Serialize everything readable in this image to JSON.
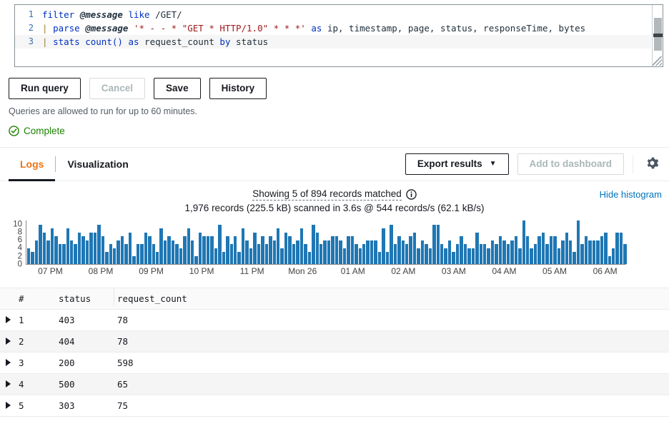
{
  "editor": {
    "lines": [
      {
        "num": "1",
        "text": "filter @message like /GET/"
      },
      {
        "num": "2",
        "text": "| parse @message '* - - * \"GET * HTTP/1.0\" * * *' as ip, timestamp, page, status, responseTime, bytes"
      },
      {
        "num": "3",
        "text": "| stats count() as request_count by status"
      }
    ],
    "tokens": {
      "kw_filter": "filter",
      "fld_message": "@message",
      "kw_like": "like",
      "regex_get": "/GET/",
      "pipe": "|",
      "kw_parse": "parse",
      "str_pattern_a": "'* - - * \"GET * HTTP/1.0\" * * *'",
      "kw_as": "as",
      "fields_list": "ip, timestamp, page, status, responseTime, bytes",
      "kw_stats": "stats",
      "fn_count": "count()",
      "alias_request_count": "request_count",
      "kw_by": "by",
      "field_status": "status"
    }
  },
  "toolbar": {
    "run_label": "Run query",
    "cancel_label": "Cancel",
    "save_label": "Save",
    "history_label": "History",
    "hint": "Queries are allowed to run for up to 60 minutes.",
    "status_label": "Complete",
    "status_color": "#1d8102"
  },
  "tabs": {
    "items": [
      {
        "label": "Logs",
        "active": true
      },
      {
        "label": "Visualization",
        "active": false
      }
    ],
    "export_label": "Export results",
    "export_caret": "▼",
    "add_dashboard_label": "Add to dashboard",
    "gear_icon": "gear-icon",
    "accent_color": "#ec7211"
  },
  "results": {
    "showing_text": "Showing 5 of 894 records matched",
    "info_icon": "info-icon",
    "scan_text": "1,976 records (225.5 kB) scanned in 3.6s @ 544 records/s (62.1 kB/s)",
    "hide_histogram_label": "Hide histogram",
    "link_color": "#0073bb"
  },
  "chart_data": {
    "type": "bar",
    "title": "",
    "xlabel": "",
    "ylabel": "",
    "ylim": [
      0,
      11
    ],
    "grid": false,
    "legend": false,
    "bar_color": "#1f77b4",
    "yticks": [
      0,
      2,
      4,
      6,
      8,
      10
    ],
    "xticks": [
      {
        "label": "07 PM",
        "pos_pct": 4.1
      },
      {
        "label": "08 PM",
        "pos_pct": 12.5
      },
      {
        "label": "09 PM",
        "pos_pct": 20.9
      },
      {
        "label": "10 PM",
        "pos_pct": 29.3
      },
      {
        "label": "11 PM",
        "pos_pct": 37.7
      },
      {
        "label": "Mon 26",
        "pos_pct": 46.1
      },
      {
        "label": "01 AM",
        "pos_pct": 54.5
      },
      {
        "label": "02 AM",
        "pos_pct": 62.9
      },
      {
        "label": "03 AM",
        "pos_pct": 71.3
      },
      {
        "label": "04 AM",
        "pos_pct": 79.7
      },
      {
        "label": "05 AM",
        "pos_pct": 88.1
      },
      {
        "label": "06 AM",
        "pos_pct": 96.5
      }
    ],
    "values": [
      4,
      3,
      6,
      10,
      8,
      6,
      9,
      7,
      5,
      5,
      9,
      6,
      5,
      8,
      7,
      6,
      8,
      8,
      10,
      7,
      3,
      5,
      4,
      6,
      7,
      5,
      8,
      2,
      5,
      5,
      8,
      7,
      5,
      3,
      9,
      6,
      7,
      6,
      5,
      4,
      7,
      9,
      6,
      2,
      8,
      7,
      7,
      7,
      4,
      10,
      3,
      7,
      5,
      7,
      3,
      9,
      6,
      4,
      8,
      5,
      7,
      5,
      7,
      6,
      9,
      4,
      8,
      7,
      5,
      6,
      9,
      5,
      3,
      10,
      8,
      5,
      6,
      6,
      7,
      7,
      6,
      4,
      7,
      7,
      5,
      4,
      5,
      6,
      6,
      6,
      3,
      9,
      3,
      10,
      5,
      7,
      6,
      5,
      7,
      8,
      4,
      6,
      5,
      4,
      10,
      10,
      5,
      4,
      6,
      3,
      5,
      7,
      5,
      4,
      4,
      8,
      5,
      5,
      4,
      6,
      5,
      7,
      6,
      5,
      6,
      7,
      4,
      11,
      7,
      4,
      5,
      7,
      8,
      5,
      7,
      7,
      4,
      6,
      8,
      6,
      3,
      11,
      5,
      7,
      6,
      6,
      6,
      7,
      8,
      2,
      4,
      8,
      8,
      5
    ]
  },
  "table": {
    "columns": [
      "#",
      "status",
      "request_count"
    ],
    "rows": [
      {
        "n": "1",
        "status": "403",
        "request_count": "78"
      },
      {
        "n": "2",
        "status": "404",
        "request_count": "78"
      },
      {
        "n": "3",
        "status": "200",
        "request_count": "598"
      },
      {
        "n": "4",
        "status": "500",
        "request_count": "65"
      },
      {
        "n": "5",
        "status": "303",
        "request_count": "75"
      }
    ]
  }
}
